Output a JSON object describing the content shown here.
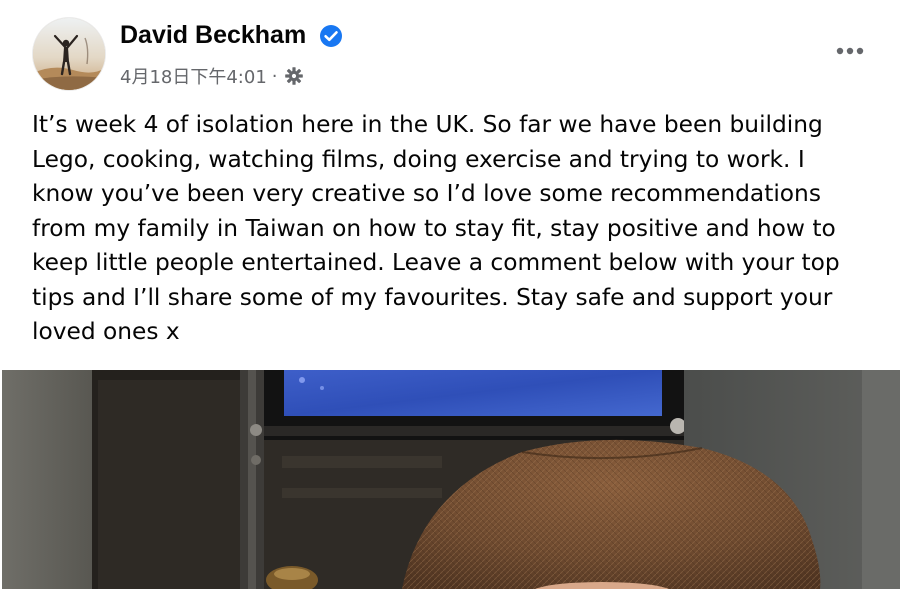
{
  "post": {
    "author": {
      "name": "David Beckham",
      "verified": true,
      "avatar_icon": "profile-photo-avatar"
    },
    "meta": {
      "timestamp": "4月18日下午4:01",
      "separator": "·",
      "audience_icon": "gear-icon"
    },
    "more_icon": "more-horizontal-icon",
    "text_lines": [
      "It’s week 4 of isolation here in the UK. So far we have been building",
      "Lego, cooking, watching films, doing exercise and trying to work. I",
      "know you’ve been very creative so I’d love some recommendations",
      "from my family in Taiwan on how to stay fit, stay positive and how to",
      "keep little people entertained. Leave a comment below with your top",
      "tips and I’ll share some of my favourites. Stay safe and support your",
      "loved ones x"
    ],
    "photo": {
      "subject_icon": "post-photo"
    }
  },
  "colors": {
    "text_primary": "#050505",
    "text_secondary": "#65676b",
    "verified_blue": "#1877f2",
    "background": "#ffffff"
  }
}
